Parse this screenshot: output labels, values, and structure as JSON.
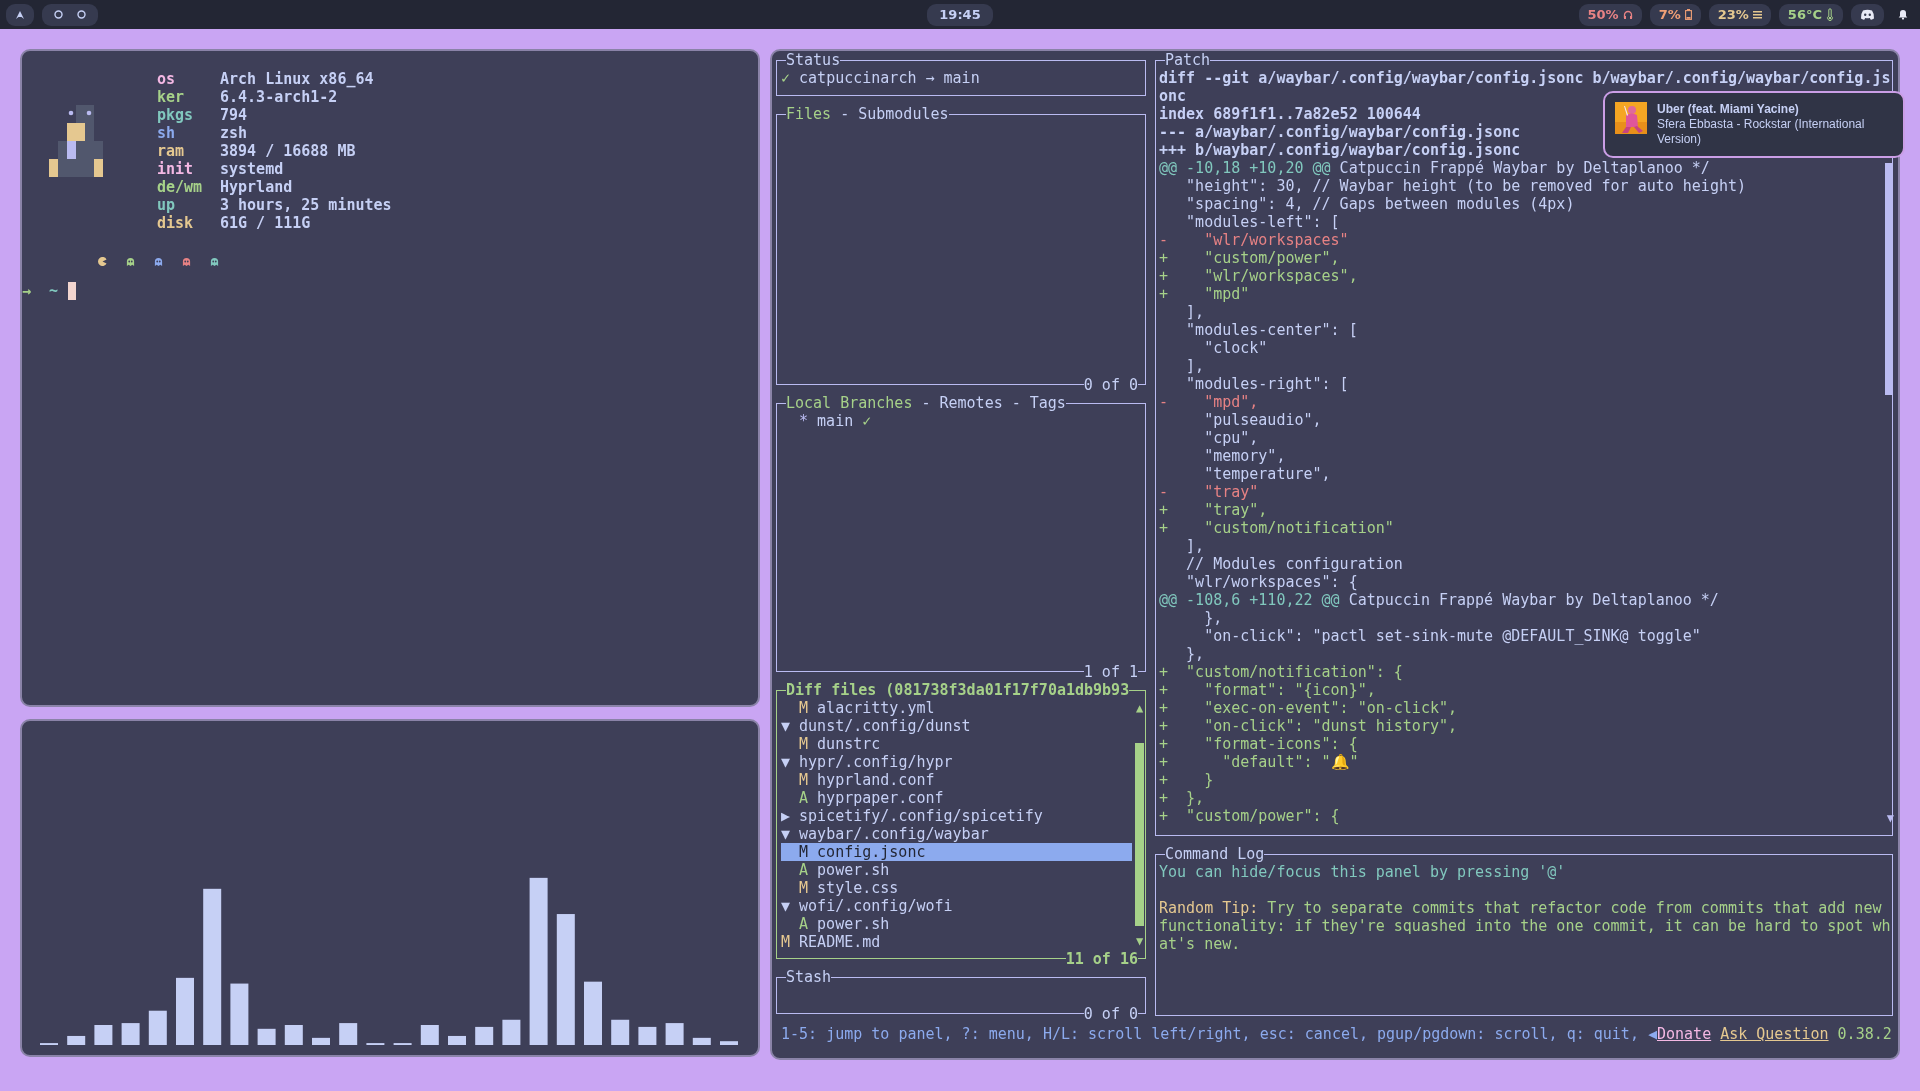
{
  "top_bar": {
    "clock": "19:45",
    "modules": [
      {
        "kind": "volume",
        "text": "50%",
        "color": "#e78284"
      },
      {
        "kind": "battery",
        "text": "7%",
        "color": "#ef9f76"
      },
      {
        "kind": "memory",
        "text": "23%",
        "color": "#e5c890"
      },
      {
        "kind": "temperature",
        "text": "56°C",
        "color": "#a6d189"
      }
    ]
  },
  "terminal": {
    "info": [
      {
        "key": "os",
        "value": "Arch Linux x86_64",
        "color": "#f4b8e4"
      },
      {
        "key": "ker",
        "value": "6.4.3-arch1-2",
        "color": "#a6d189"
      },
      {
        "key": "pkgs",
        "value": "794",
        "color": "#81c8be"
      },
      {
        "key": "sh",
        "value": "zsh",
        "color": "#8caaee"
      },
      {
        "key": "ram",
        "value": "3894 / 16688 MB",
        "color": "#e5c890"
      },
      {
        "key": "init",
        "value": "systemd",
        "color": "#f4b8e4"
      },
      {
        "key": "de/wm",
        "value": "Hyprland",
        "color": "#a6d189"
      },
      {
        "key": "up",
        "value": "3 hours, 25 minutes",
        "color": "#81c8be"
      },
      {
        "key": "disk",
        "value": "61G / 111G",
        "color": "#e5c890"
      }
    ],
    "palette": [
      {
        "kind": "pacman",
        "color": "#e5c890"
      },
      {
        "kind": "ghost",
        "color": "#a6d189"
      },
      {
        "kind": "ghost",
        "color": "#8caaee"
      },
      {
        "kind": "ghost",
        "color": "#e78284"
      },
      {
        "kind": "ghost",
        "color": "#81c8be"
      }
    ],
    "prompt": {
      "arrow": "→",
      "path": "~"
    }
  },
  "lazygit": {
    "status": {
      "title": "Status",
      "focused": false,
      "mark": "✓",
      "text": "catpuccinarch → main"
    },
    "files": {
      "focused": false,
      "separator": "-",
      "tabs": [
        {
          "label": "Files",
          "selected": true
        },
        {
          "label": "Submodules",
          "selected": false
        }
      ],
      "counter": "0 of 0"
    },
    "branches": {
      "focused": false,
      "separator": "-",
      "tabs": [
        {
          "label": "Local Branches",
          "selected": true
        },
        {
          "label": "Remotes",
          "selected": false
        },
        {
          "label": "Tags",
          "selected": false
        }
      ],
      "items": [
        {
          "marker": "*",
          "name": "main",
          "status": "✓"
        }
      ],
      "counter": "1 of 1"
    },
    "diff_files": {
      "title": "Diff files (081738f3da01f17f70a1db9b93",
      "focused": true,
      "scroll_up": "▲",
      "scroll_down": "▼",
      "counter": "11 of 16",
      "tree": [
        {
          "children": [
            {
              "status": "M",
              "kind": "modified",
              "name": "alacritty.yml",
              "selected": false
            }
          ]
        },
        {
          "toggle": "▼",
          "name": "dunst/.config/dunst",
          "selected": false,
          "children": [
            {
              "status": "M",
              "kind": "modified",
              "name": "dunstrc",
              "selected": false
            }
          ]
        },
        {
          "toggle": "▼",
          "name": "hypr/.config/hypr",
          "selected": false,
          "children": [
            {
              "status": "M",
              "kind": "modified",
              "name": "hyprland.conf",
              "selected": false
            },
            {
              "status": "A",
              "kind": "added",
              "name": "hyprpaper.conf",
              "selected": false
            }
          ]
        },
        {
          "toggle": "▶",
          "name": "spicetify/.config/spicetify",
          "selected": false
        },
        {
          "toggle": "▼",
          "name": "waybar/.config/waybar",
          "selected": false,
          "children": [
            {
              "status": "M",
              "kind": "modified",
              "name": "config.jsonc",
              "selected": true
            },
            {
              "status": "A",
              "kind": "added",
              "name": "power.sh",
              "selected": false
            },
            {
              "status": "M",
              "kind": "modified",
              "name": "style.css",
              "selected": false
            }
          ]
        },
        {
          "toggle": "▼",
          "name": "wofi/.config/wofi",
          "selected": false,
          "children": [
            {
              "status": "A",
              "kind": "added",
              "name": "power.sh",
              "selected": false
            }
          ]
        },
        {
          "status": "M",
          "kind": "modified",
          "name": "README.md",
          "selected": false
        }
      ]
    },
    "stash": {
      "title": "Stash",
      "focused": false,
      "counter": "0 of 0"
    },
    "patch": {
      "title": "Patch",
      "focused": false,
      "scroll_down": "▼",
      "lines": [
        {
          "kind": "header",
          "text": "diff --git a/waybar/.config/waybar/config.jsonc b/waybar/.config/waybar/config.js"
        },
        {
          "kind": "header",
          "text": "onc"
        },
        {
          "kind": "header",
          "text": "index 689f1f1..7a82e52 100644"
        },
        {
          "kind": "header",
          "text": "--- a/waybar/.config/waybar/config.jsonc"
        },
        {
          "kind": "header",
          "text": "+++ b/waybar/.config/waybar/config.jsonc"
        },
        {
          "kind": "hunk",
          "range": "@@ -10,18 +10,20 @@",
          "text": "Catpuccin Frappé Waybar by Deltaplanoo */"
        },
        {
          "kind": "context",
          "text": "   \"height\": 30, // Waybar height (to be removed for auto height)"
        },
        {
          "kind": "context",
          "text": "   \"spacing\": 4, // Gaps between modules (4px)"
        },
        {
          "kind": "context",
          "text": "   \"modules-left\": ["
        },
        {
          "kind": "del",
          "text": "-    \"wlr/workspaces\""
        },
        {
          "kind": "add",
          "text": "+    \"custom/power\","
        },
        {
          "kind": "add",
          "text": "+    \"wlr/workspaces\","
        },
        {
          "kind": "add",
          "text": "+    \"mpd\""
        },
        {
          "kind": "context",
          "text": "   ],"
        },
        {
          "kind": "context",
          "text": "   \"modules-center\": ["
        },
        {
          "kind": "context",
          "text": "     \"clock\""
        },
        {
          "kind": "context",
          "text": "   ],"
        },
        {
          "kind": "context",
          "text": "   \"modules-right\": ["
        },
        {
          "kind": "del",
          "text": "-    \"mpd\","
        },
        {
          "kind": "context",
          "text": "     \"pulseaudio\","
        },
        {
          "kind": "context",
          "text": "     \"cpu\","
        },
        {
          "kind": "context",
          "text": "     \"memory\","
        },
        {
          "kind": "context",
          "text": "     \"temperature\","
        },
        {
          "kind": "del",
          "text": "-    \"tray\""
        },
        {
          "kind": "add",
          "text": "+    \"tray\","
        },
        {
          "kind": "add",
          "text": "+    \"custom/notification\""
        },
        {
          "kind": "context",
          "text": "   ],"
        },
        {
          "kind": "context",
          "text": "   // Modules configuration"
        },
        {
          "kind": "context",
          "text": "   \"wlr/workspaces\": {"
        },
        {
          "kind": "hunk",
          "range": "@@ -108,6 +110,22 @@",
          "text": "Catpuccin Frappé Waybar by Deltaplanoo */"
        },
        {
          "kind": "context",
          "text": "     },"
        },
        {
          "kind": "context",
          "text": "     \"on-click\": \"pactl set-sink-mute @DEFAULT_SINK@ toggle\""
        },
        {
          "kind": "context",
          "text": "   },"
        },
        {
          "kind": "add",
          "text": "+  \"custom/notification\": {"
        },
        {
          "kind": "add",
          "text": "+    \"format\": \"{icon}\","
        },
        {
          "kind": "add",
          "text": "+    \"exec-on-event\": \"on-click\","
        },
        {
          "kind": "add",
          "text": "+    \"on-click\": \"dunst history\","
        },
        {
          "kind": "add",
          "text": "+    \"format-icons\": {"
        },
        {
          "kind": "add",
          "text": "+      \"default\": \"🔔\""
        },
        {
          "kind": "add",
          "text": "+    }"
        },
        {
          "kind": "add",
          "text": "+  },"
        },
        {
          "kind": "add",
          "text": "+  \"custom/power\": {"
        }
      ]
    },
    "command_log": {
      "title": "Command Log",
      "focused": false,
      "message": "You can hide/focus this panel by pressing '@'",
      "tip": {
        "label": "Random Tip:",
        "lines": [
          "Try to separate commits that refactor code from commits that add new",
          "functionality: if they're squashed into the one commit, it can be hard to spot wh",
          "at's new."
        ]
      }
    },
    "footer": {
      "hints": "1-5: jump to panel, ?: menu, H/L: scroll left/right, esc: cancel, pgup/pgdown: scroll, q: quit,",
      "marker": "◀",
      "links": [
        {
          "kind": "donate",
          "text": "Donate"
        },
        {
          "kind": "ask",
          "text": "Ask Question"
        }
      ],
      "version": "0.38.2"
    }
  },
  "notification": {
    "title": "Uber (feat. Miami Yacine)",
    "body": "Sfera Ebbasta - Rockstar (International Version)"
  }
}
